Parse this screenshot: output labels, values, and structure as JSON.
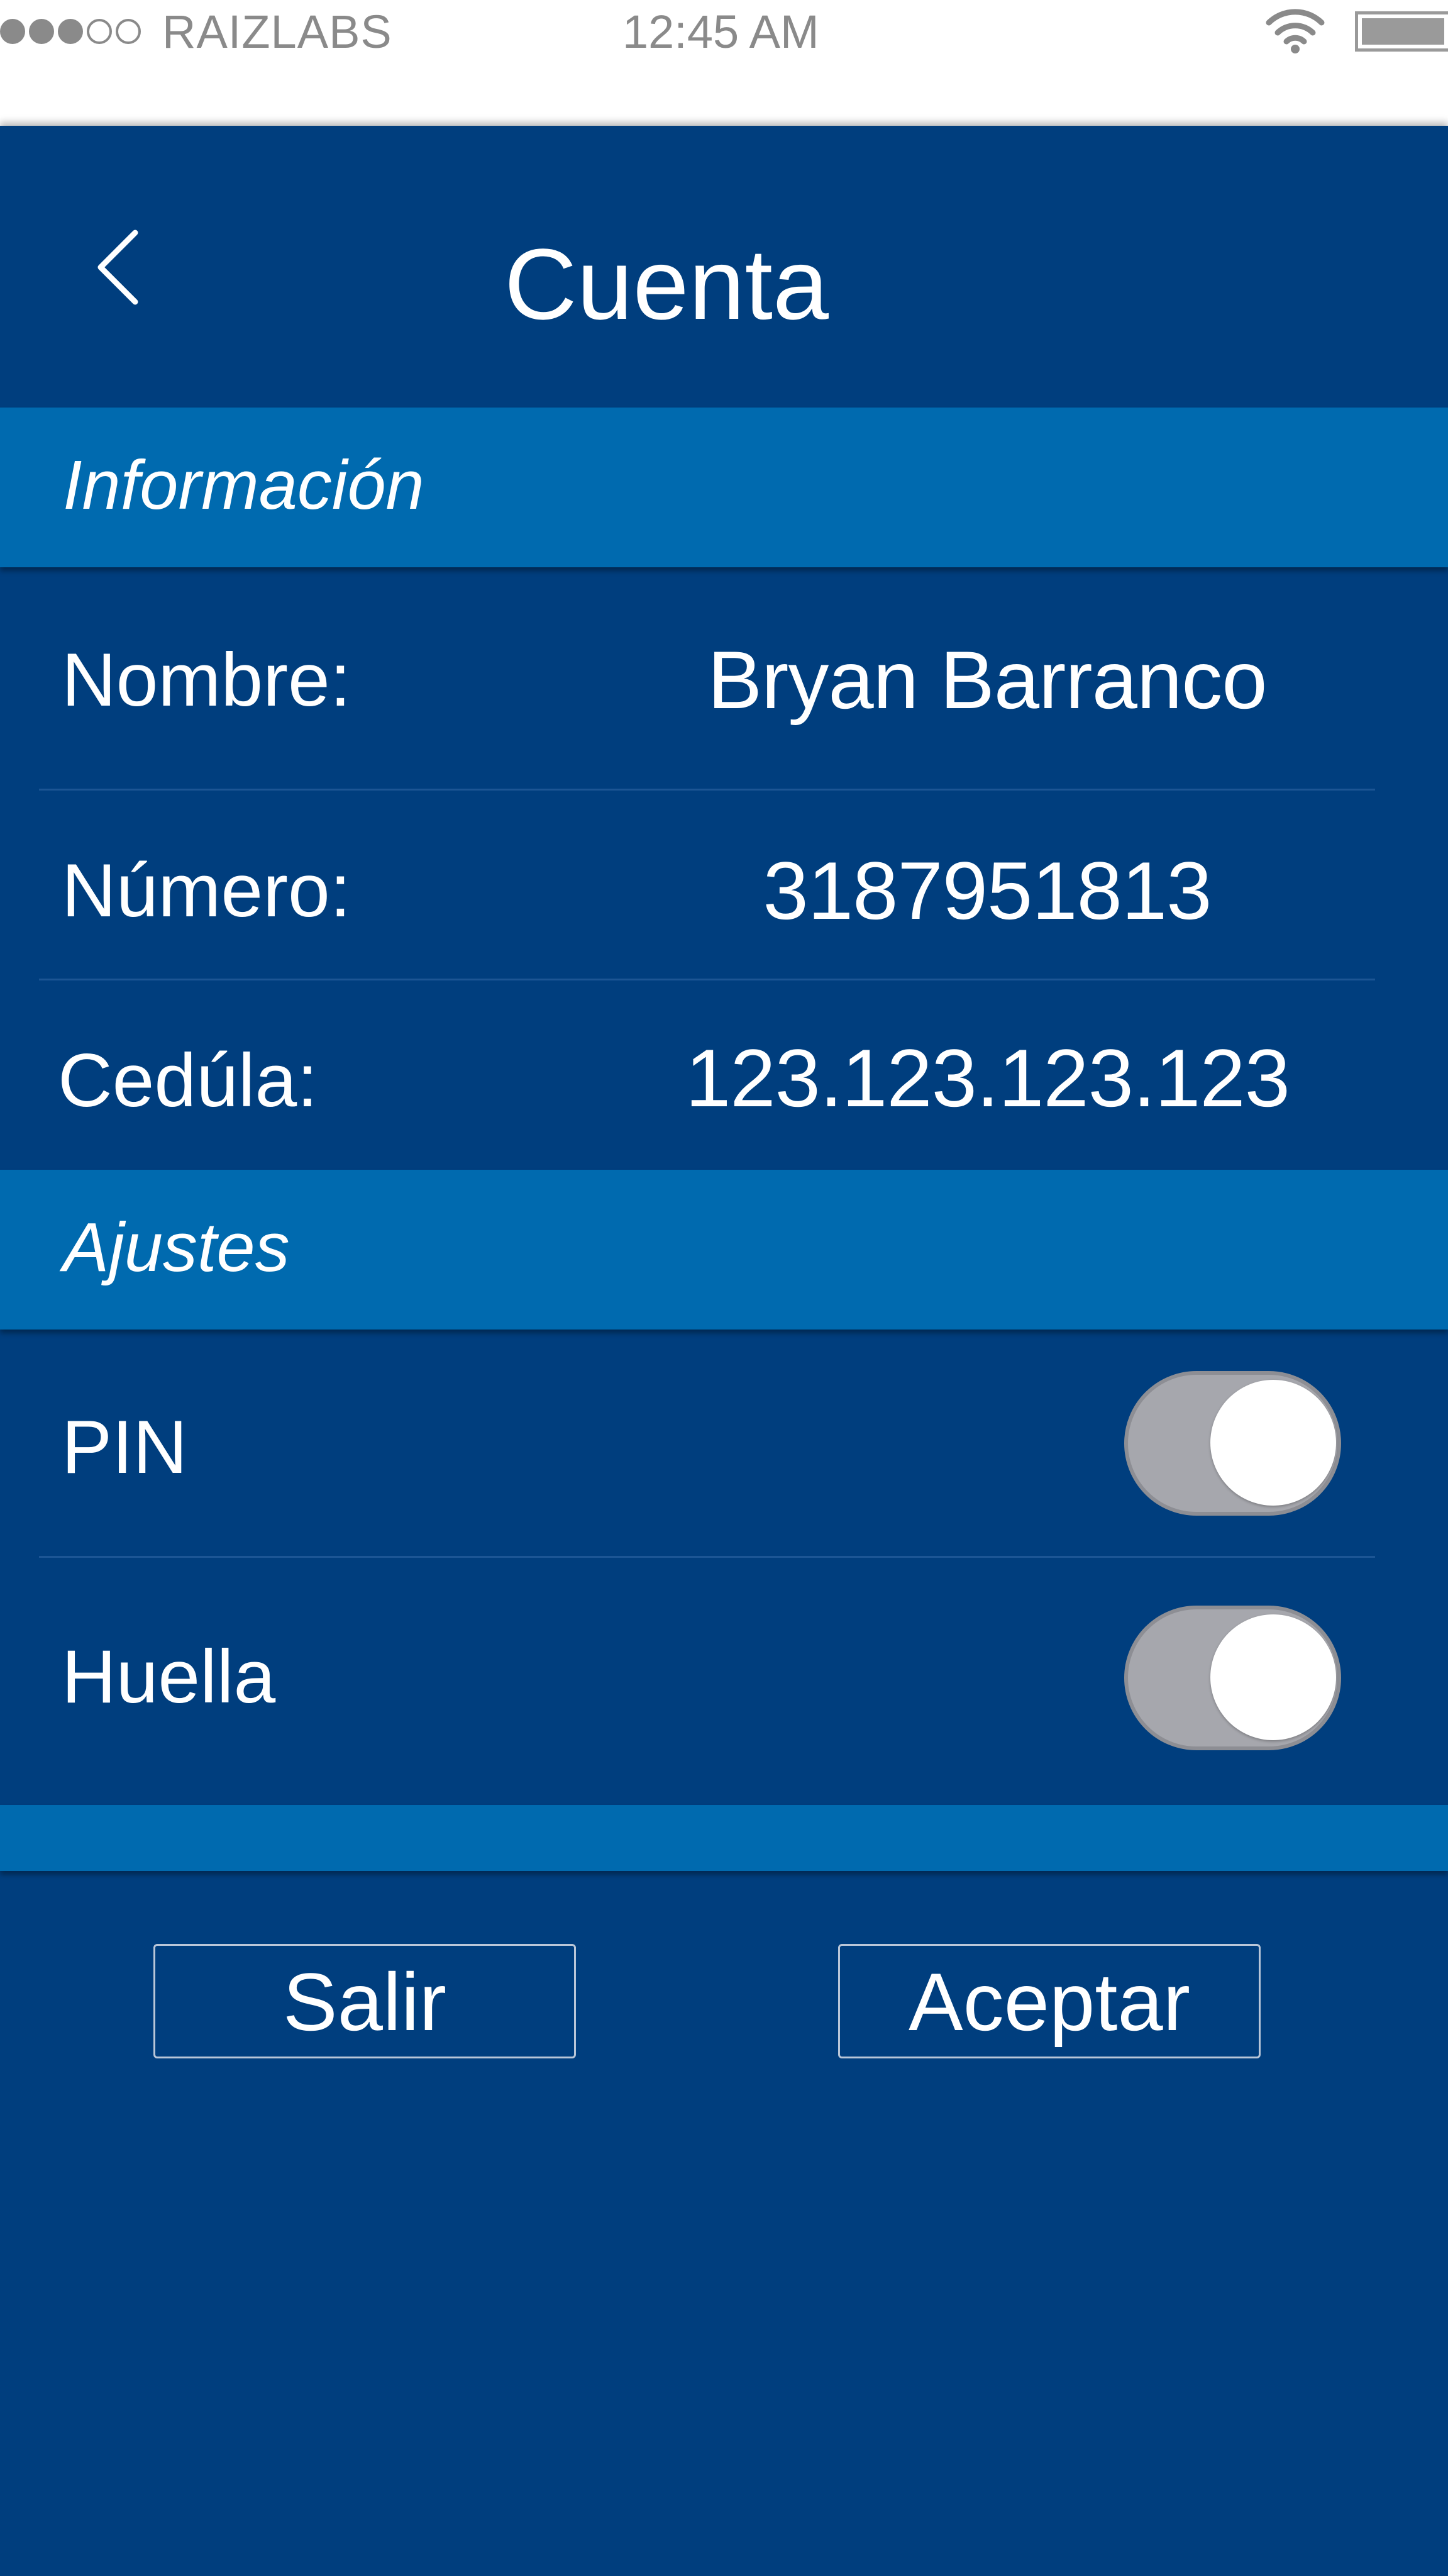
{
  "status_bar": {
    "signal_strength_bars": 3,
    "signal_total_bars": 5,
    "carrier": "RAIZLABS",
    "time": "12:45 AM",
    "wifi_icon": "wifi-icon",
    "battery_icon": "battery-icon",
    "battery_level_fraction": 1.0
  },
  "header": {
    "title": "Cuenta",
    "back_icon": "chevron-left-icon"
  },
  "informacion": {
    "section_title": "Información",
    "rows": [
      {
        "label": "Nombre:",
        "value": "Bryan Barranco"
      },
      {
        "label": "Número:",
        "value": "3187951813"
      },
      {
        "label": "Cedúla:",
        "value": "123.123.123.123"
      }
    ]
  },
  "ajustes": {
    "section_title": "Ajustes",
    "toggles": [
      {
        "label": "PIN",
        "state": "on"
      },
      {
        "label": "Huella",
        "state": "on"
      }
    ]
  },
  "actions": {
    "exit_label": "Salir",
    "accept_label": "Aceptar"
  },
  "colors": {
    "background": "#003e7e",
    "section_bar": "#006aaf",
    "toggle_track": "#a6a7ad",
    "text": "#ffffff",
    "status_text": "#8a8a8a"
  }
}
